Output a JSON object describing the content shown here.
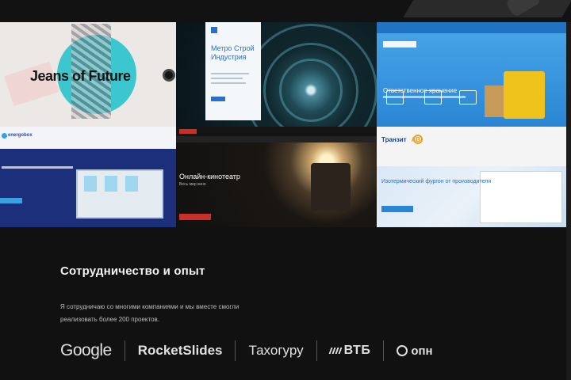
{
  "portfolio": {
    "tiles": [
      {
        "title": "Jeans of Future"
      },
      {
        "card_title": "Метро Строй Индустрия"
      },
      {
        "headline": "Ответственное хранение"
      },
      {
        "logo": "energobox"
      },
      {
        "headline": "Онлайн-кинотеатр",
        "subline": "Весь мир кино"
      },
      {
        "logo": "Транзит",
        "logo_suffix": "АВ",
        "headline": "Изотермический фургон от производителя"
      }
    ]
  },
  "section": {
    "title": "Сотрудничество и опыт",
    "text": "Я сотрудничаю со многими компаниями и мы вместе смогли реализовать более 200 проектов."
  },
  "partners": [
    "Google",
    "RocketSlides",
    "Тахогуру",
    "ВТБ",
    "опн"
  ]
}
